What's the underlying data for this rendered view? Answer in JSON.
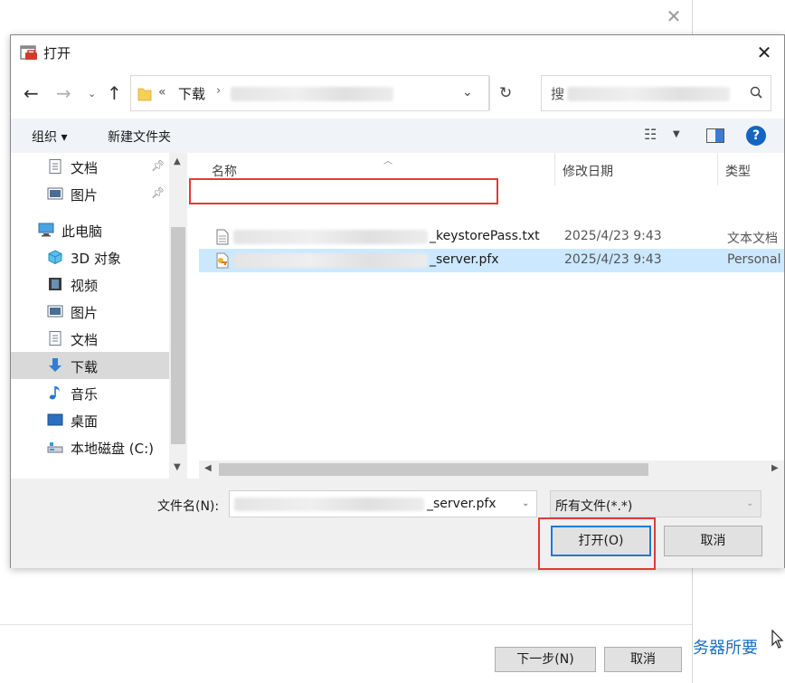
{
  "background": {
    "next_label": "下一步(N)",
    "cancel_label": "取消",
    "link_text": "务器所要"
  },
  "dialog": {
    "title": "打开",
    "address": {
      "overflow": "«",
      "folder": "下载",
      "separator": "›"
    },
    "search": {
      "placeholder": "搜"
    },
    "toolbar": {
      "organize": "组织 ▾",
      "new_folder": "新建文件夹"
    },
    "nav_items": [
      {
        "label": "文档",
        "icon": "document-icon",
        "pinned": true
      },
      {
        "label": "图片",
        "icon": "picture-icon",
        "pinned": true
      },
      {
        "label": "此电脑",
        "icon": "computer-icon"
      },
      {
        "label": "3D 对象",
        "icon": "3d-object-icon"
      },
      {
        "label": "视频",
        "icon": "video-icon"
      },
      {
        "label": "图片",
        "icon": "picture-icon"
      },
      {
        "label": "文档",
        "icon": "document-icon"
      },
      {
        "label": "下载",
        "icon": "download-icon",
        "selected": true
      },
      {
        "label": "音乐",
        "icon": "music-icon"
      },
      {
        "label": "桌面",
        "icon": "desktop-icon"
      },
      {
        "label": "本地磁盘 (C:)",
        "icon": "drive-icon"
      }
    ],
    "columns": {
      "name": "名称",
      "date": "修改日期",
      "type": "类型"
    },
    "files": [
      {
        "name_suffix": "_keystorePass.txt",
        "date": "2025/4/23 9:43",
        "type": "文本文档",
        "icon": "text-file-icon"
      },
      {
        "name_suffix": "_server.pfx",
        "date": "2025/4/23 9:43",
        "type": "Personal I",
        "icon": "certificate-file-icon",
        "selected": true
      }
    ],
    "filename": {
      "label": "文件名(N):",
      "value_suffix": "_server.pfx"
    },
    "filetype": {
      "value": "所有文件(*.*)"
    },
    "buttons": {
      "open": "打开(O)",
      "cancel": "取消"
    }
  },
  "colors": {
    "highlight": "#e03a3a",
    "selection": "#cce8ff",
    "accent": "#1e7ad6"
  }
}
